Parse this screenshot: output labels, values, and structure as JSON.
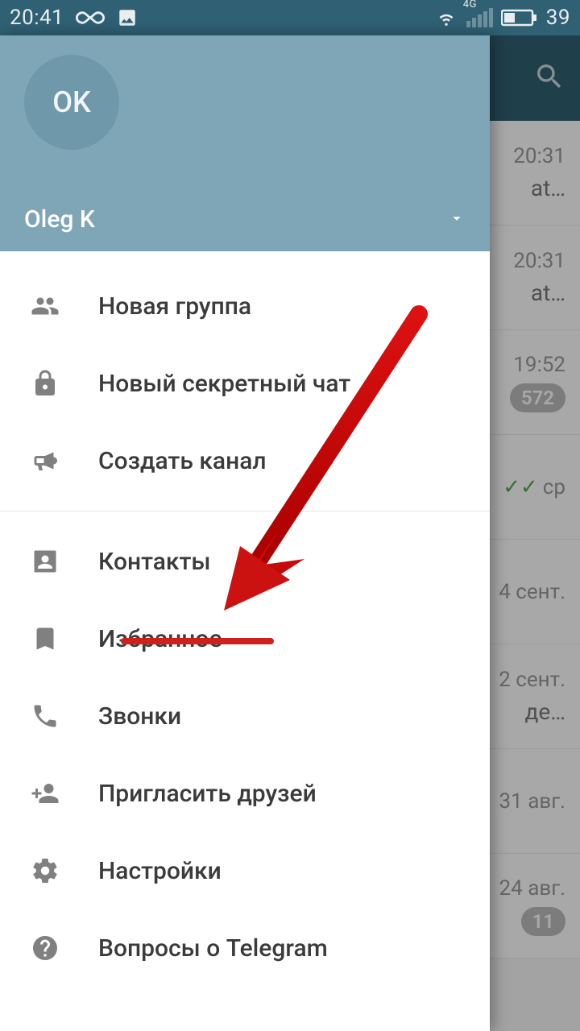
{
  "status": {
    "time": "20:41",
    "battery": "39",
    "network_label": "4G"
  },
  "drawer": {
    "avatar_initials": "OK",
    "user_name": "Oleg K",
    "menu1": [
      {
        "key": "new-group",
        "label": "Новая группа"
      },
      {
        "key": "secret-chat",
        "label": "Новый секретный чат"
      },
      {
        "key": "new-channel",
        "label": "Создать канал"
      }
    ],
    "menu2": [
      {
        "key": "contacts",
        "label": "Контакты"
      },
      {
        "key": "saved",
        "label": "Избранное"
      },
      {
        "key": "calls",
        "label": "Звонки"
      },
      {
        "key": "invite",
        "label": "Пригласить друзей"
      },
      {
        "key": "settings",
        "label": "Настройки"
      },
      {
        "key": "faq",
        "label": "Вопросы о Telegram"
      }
    ]
  },
  "chats": [
    {
      "time": "20:31",
      "snippet": "at…",
      "badge": "",
      "check": ""
    },
    {
      "time": "20:31",
      "snippet": "at…",
      "badge": "",
      "check": ""
    },
    {
      "time": "19:52",
      "snippet": "",
      "badge": "572",
      "check": ""
    },
    {
      "time": "ср",
      "snippet": "",
      "badge": "",
      "check": "✓✓"
    },
    {
      "time": "4 сент.",
      "snippet": "",
      "badge": "",
      "check": ""
    },
    {
      "time": "2 сент.",
      "snippet": "де…",
      "badge": "",
      "check": ""
    },
    {
      "time": "31 авг.",
      "snippet": "",
      "badge": "",
      "check": ""
    },
    {
      "time": "24 авг.",
      "snippet": "",
      "badge": "11",
      "check": ""
    }
  ],
  "annotation": {
    "target_key": "saved"
  }
}
